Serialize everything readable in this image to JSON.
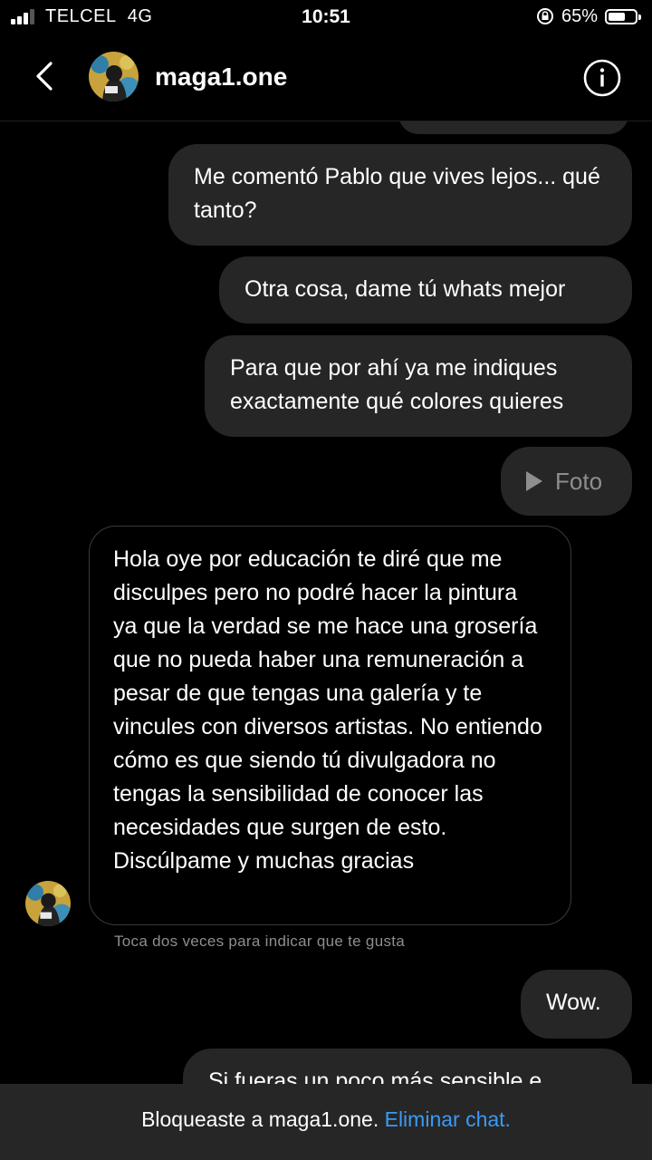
{
  "status_bar": {
    "carrier": "TELCEL",
    "network": "4G",
    "time": "10:51",
    "battery": "65%",
    "battery_level": 0.65
  },
  "header": {
    "username": "maga1.one",
    "back_icon": "chevron-left-icon",
    "info_icon": "info-icon"
  },
  "messages": {
    "out1": "Me comentó Pablo que vives lejos... qué tanto?",
    "out2": "Otra cosa, dame tú whats mejor",
    "out3": "Para que por ahí ya me indiques exactamente qué colores quieres",
    "out4": "Foto",
    "in1": "Hola oye por educación te diré que me disculpes pero no podré hacer la pintura ya que la verdad se me hace una grosería que no pueda haber una remuneración a pesar de que tengas una galería y te vincules con diversos artistas. No entiendo cómo es que siendo tú divulgadora no tengas la sensibilidad de conocer las necesidades que surgen de esto. Discúlpame y muchas gracias",
    "hint": "Toca dos veces para indicar que te gusta",
    "out5": "Wow.",
    "out6": "Si fueras un poco más sensible e"
  },
  "bottom_bar": {
    "text": "Bloqueaste a maga1.one.",
    "link": "Eliminar chat."
  },
  "colors": {
    "background": "#000000",
    "bubble": "#262626",
    "link": "#3b9af5",
    "muted": "#8e8e8e"
  }
}
